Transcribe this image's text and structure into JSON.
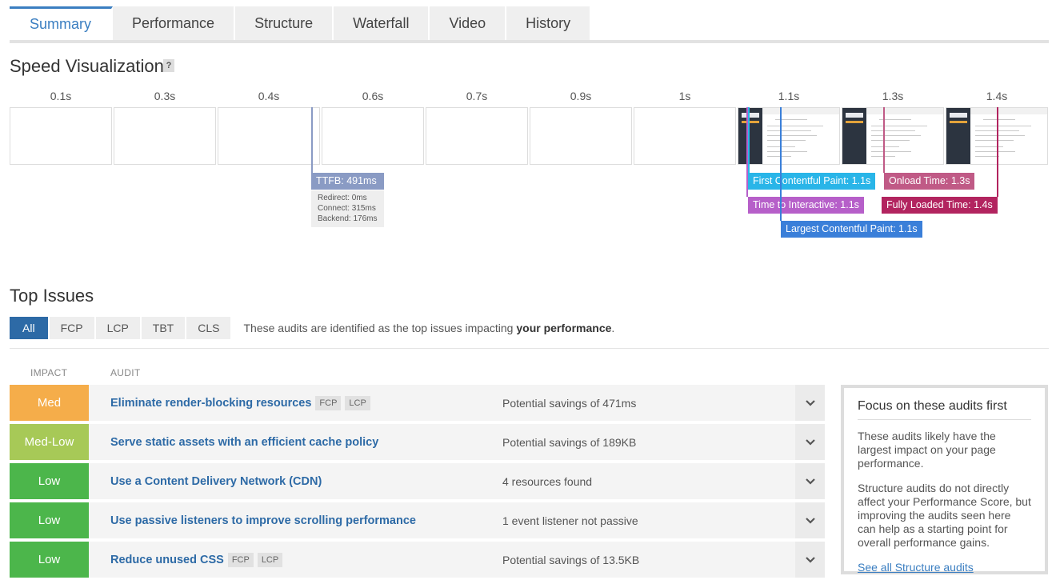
{
  "tabs": [
    {
      "label": "Summary",
      "active": true
    },
    {
      "label": "Performance",
      "active": false
    },
    {
      "label": "Structure",
      "active": false
    },
    {
      "label": "Waterfall",
      "active": false
    },
    {
      "label": "Video",
      "active": false
    },
    {
      "label": "History",
      "active": false
    }
  ],
  "speed": {
    "title": "Speed Visualization",
    "help": "?",
    "frames": [
      {
        "label": "0.1s",
        "shot": false
      },
      {
        "label": "0.3s",
        "shot": false
      },
      {
        "label": "0.4s",
        "shot": false
      },
      {
        "label": "0.6s",
        "shot": false
      },
      {
        "label": "0.7s",
        "shot": false
      },
      {
        "label": "0.9s",
        "shot": false
      },
      {
        "label": "1s",
        "shot": false
      },
      {
        "label": "1.1s",
        "shot": true
      },
      {
        "label": "1.3s",
        "shot": true
      },
      {
        "label": "1.4s",
        "shot": true
      }
    ],
    "ttfb": {
      "label": "TTFB: 491ms",
      "redirect": "Redirect: 0ms",
      "connect": "Connect: 315ms",
      "backend": "Backend: 176ms"
    },
    "markers": {
      "fcp": "First Contentful Paint: 1.1s",
      "tti": "Time to Interactive: 1.1s",
      "lcp": "Largest Contentful Paint: 1.1s",
      "onload": "Onload Time: 1.3s",
      "fully": "Fully Loaded Time: 1.4s"
    },
    "colors": {
      "ttfb": "#8a9bc4",
      "fcp": "#29b5e8",
      "tti": "#b65fc9",
      "lcp": "#3a7fd9",
      "onload": "#c05a86",
      "fully": "#b2245f"
    }
  },
  "issues": {
    "title": "Top Issues",
    "filters": [
      {
        "label": "All",
        "active": true
      },
      {
        "label": "FCP",
        "active": false
      },
      {
        "label": "LCP",
        "active": false
      },
      {
        "label": "TBT",
        "active": false
      },
      {
        "label": "CLS",
        "active": false
      }
    ],
    "desc_prefix": "These audits are identified as the top issues impacting ",
    "desc_bold": "your performance",
    "desc_suffix": ".",
    "col_impact": "IMPACT",
    "col_audit": "AUDIT",
    "rows": [
      {
        "impact": "Med",
        "color": "#f5ad4a",
        "name": "Eliminate render-blocking resources",
        "tags": [
          "FCP",
          "LCP"
        ],
        "savings": "Potential savings of 471ms"
      },
      {
        "impact": "Med-Low",
        "color": "#a7c957",
        "name": "Serve static assets with an efficient cache policy",
        "tags": [],
        "savings": "Potential savings of 189KB"
      },
      {
        "impact": "Low",
        "color": "#4cb64b",
        "name": "Use a Content Delivery Network (CDN)",
        "tags": [],
        "savings": "4 resources found"
      },
      {
        "impact": "Low",
        "color": "#4cb64b",
        "name": "Use passive listeners to improve scrolling performance",
        "tags": [],
        "savings": "1 event listener not passive"
      },
      {
        "impact": "Low",
        "color": "#4cb64b",
        "name": "Reduce unused CSS",
        "tags": [
          "FCP",
          "LCP"
        ],
        "savings": "Potential savings of 13.5KB"
      }
    ]
  },
  "focus": {
    "title": "Focus on these audits first",
    "p1": "These audits likely have the largest impact on your page performance.",
    "p2": "Structure audits do not directly affect your Performance Score, but improving the audits seen here can help as a starting point for overall performance gains.",
    "link": "See all Structure audits"
  }
}
